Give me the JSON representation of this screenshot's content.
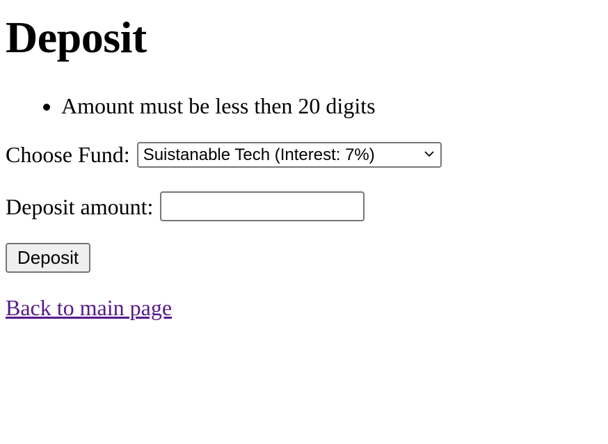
{
  "page": {
    "title": "Deposit"
  },
  "errors": [
    "Amount must be less then 20 digits"
  ],
  "fund": {
    "label": "Choose Fund:",
    "selected": "Suistanable Tech (Interest: 7%)",
    "chevron_icon": "chevron-down-icon"
  },
  "amount": {
    "label": "Deposit amount:",
    "value": "",
    "placeholder": ""
  },
  "actions": {
    "deposit_label": "Deposit",
    "back_link_label": "Back to main page"
  },
  "colors": {
    "visited_link": "#551a8b",
    "control_border": "#767676",
    "button_background": "#efefef"
  }
}
